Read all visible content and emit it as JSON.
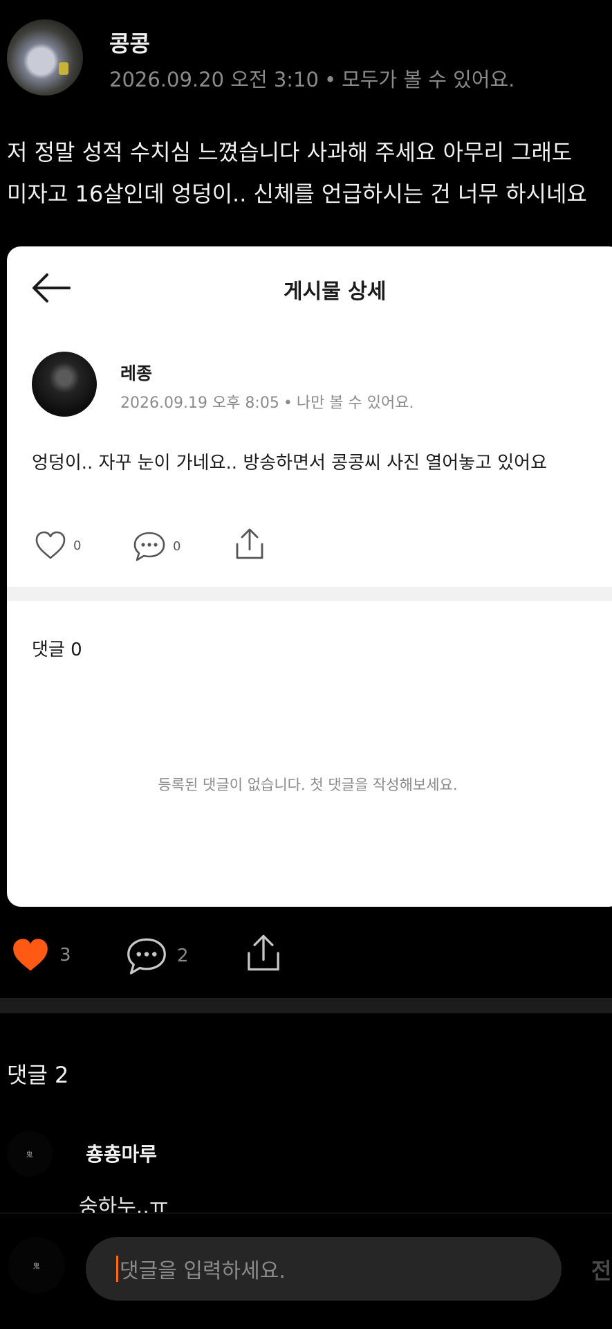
{
  "post": {
    "author": "콩콩",
    "date": "2026.09.20 오전 3:10",
    "separator": "•",
    "visibility": "모두가 볼 수 있어요.",
    "body_line1": "저 정말 성적 수치심 느꼈습니다 사과해 주세요 아무리 그래도",
    "body_line2": "미자고 16살인데 엉덩이.. 신체를 언급하시는 건 너무 하시네요"
  },
  "embedded": {
    "title": "게시물 상세",
    "author": "레종",
    "date": "2026.09.19 오후 8:05",
    "separator": "•",
    "visibility": "나만 볼 수 있어요.",
    "body": "엉덩이..  자꾸 눈이 가네요..  방송하면서 콩콩씨 사진 열어놓고 있어요",
    "like_count": "0",
    "comment_count": "0",
    "comments_title": "댓글 0",
    "empty_message": "등록된 댓글이 없습니다. 첫 댓글을 작성해보세요."
  },
  "actions": {
    "like_count": "3",
    "comment_count": "2",
    "like_color": "#ff5a14"
  },
  "comments": {
    "title": "댓글 2",
    "items": [
      {
        "author": "춍춍마루",
        "text": "숭하누..ㅠ"
      }
    ]
  },
  "composer": {
    "placeholder": "댓글을 입력하세요.",
    "send_label": "전송",
    "caret_color": "#ff6a13"
  },
  "icons": {
    "back": "back-arrow-icon",
    "heart": "heart-icon",
    "comment": "comment-bubble-icon",
    "share": "share-icon"
  }
}
